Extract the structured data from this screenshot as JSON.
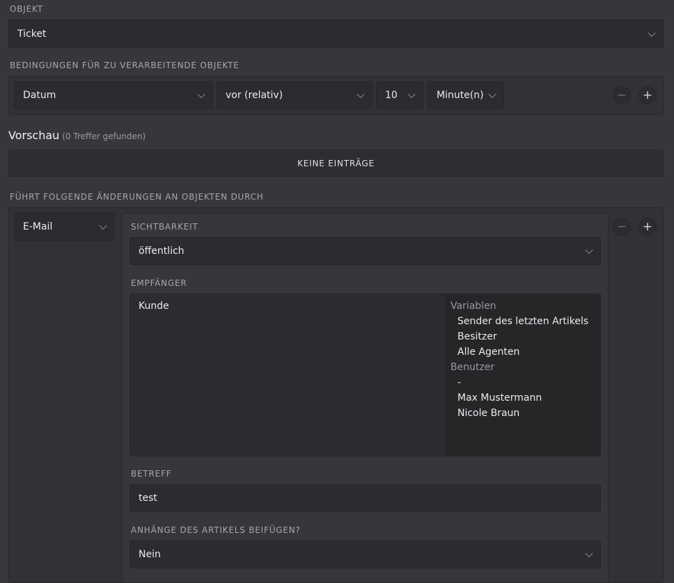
{
  "objekt": {
    "label": "OBJEKT",
    "value": "Ticket"
  },
  "conditions": {
    "label": "BEDINGUNGEN FÜR ZU VERARBEITENDE OBJEKTE",
    "attribute": "Datum",
    "operator": "vor (relativ)",
    "amount": "10",
    "unit": "Minute(n)"
  },
  "preview": {
    "title": "Vorschau",
    "subtitle": "(0 Treffer gefunden)",
    "empty_label": "KEINE EINTRÄGE"
  },
  "changes": {
    "label": "FÜHRT FOLGENDE ÄNDERUNGEN AN OBJEKTEN DURCH",
    "action_type": "E-Mail",
    "visibility": {
      "label": "SICHTBARKEIT",
      "value": "öffentlich"
    },
    "recipients": {
      "label": "EMPFÄNGER",
      "selected": [
        "Kunde"
      ],
      "groups": [
        {
          "name": "Variablen",
          "items": [
            "Sender des letzten Artikels",
            "Besitzer",
            "Alle Agenten"
          ]
        },
        {
          "name": "Benutzer",
          "items": [
            "-",
            "Max Mustermann",
            "Nicole Braun"
          ]
        }
      ]
    },
    "subject": {
      "label": "BETREFF",
      "value": "test"
    },
    "attachments": {
      "label": "ANHÄNGE DES ARTIKELS BEIFÜGEN?",
      "value": "Nein"
    }
  },
  "icons": {
    "remove": "minus-icon",
    "add": "plus-icon",
    "dropdown": "chevron-down-icon"
  },
  "colors": {
    "background": "#37373b",
    "field": "#2c2c30",
    "text": "#ececee",
    "muted": "#a6a6ac"
  }
}
